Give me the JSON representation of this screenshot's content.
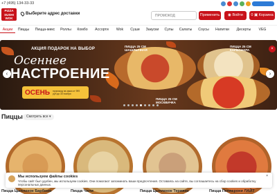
{
  "topbar": {
    "phone": "+7 (495) 134-33-33",
    "social_icons": [
      "vk-icon",
      "youtube-icon",
      "telegram-icon",
      "whatsapp-icon",
      "viber-icon",
      "app-download-icon"
    ]
  },
  "header": {
    "logo_text": "PIZZA SUSHI WOK",
    "address_label": "Выберите адрес доставки",
    "promo_placeholder": "ПРОМОКОД",
    "apply_label": "Применить",
    "login_label": "Войти",
    "cart_label": "Корзина",
    "cart_count": "0"
  },
  "nav": {
    "items": [
      {
        "label": "Акции",
        "active": true
      },
      {
        "label": "Пиццы"
      },
      {
        "label": "Пицца-микс"
      },
      {
        "label": "Роллы"
      },
      {
        "label": "Комбо"
      },
      {
        "label": "Ассорти"
      },
      {
        "label": "Wok"
      },
      {
        "label": "Суши"
      },
      {
        "label": "Закуски"
      },
      {
        "label": "Супы"
      },
      {
        "label": "Салаты"
      },
      {
        "label": "Соусы"
      },
      {
        "label": "Напитки"
      },
      {
        "label": "Десерты"
      },
      {
        "label": "VEG"
      }
    ]
  },
  "banner": {
    "promo_line": "АКЦИЯ ПОДАРОК НА ВЫБОР",
    "title_line1": "Осеннее",
    "title_line2": "НАСТРОЕНИЕ",
    "ticket_word": "ОСЕНЬ",
    "ticket_note": "промокод на заказ от 999 руб до 30 ноября",
    "labels": [
      "ПИЦЦА 25 СМ ШАШЛЫЧНАЯ",
      "ПИЦЦА 25 СМ КАРБОНАРА",
      "ПИЦЦА 25 СМ МОСКВИЧКА"
    ],
    "prev_icon": "‹",
    "next_icon": "›",
    "close_icon": "×",
    "slide_count": 9,
    "active_slide": 5
  },
  "section": {
    "title": "Пиццы",
    "view_all_label": "Смотреть все ▾"
  },
  "products": [
    {
      "name": "Пицца Цыпленок Барбекю"
    },
    {
      "name": "Пицца Чили"
    },
    {
      "name": "Пицца Цыпленок Терияки"
    },
    {
      "name": "Пицца Пепперони ЛАЙТ"
    }
  ],
  "cookie": {
    "title": "Мы используем файлы cookies",
    "text": "Чтобы сайт был удобен, мы используем cookies. Они помогают запоминать ваши предпочтения. Оставаясь на сайте, вы соглашаетесь на сбор cookies и обработку персональных данных.",
    "close_icon": "×"
  },
  "colors": {
    "brand_red": "#c8121a",
    "banner_gold": "#f5c23a"
  }
}
